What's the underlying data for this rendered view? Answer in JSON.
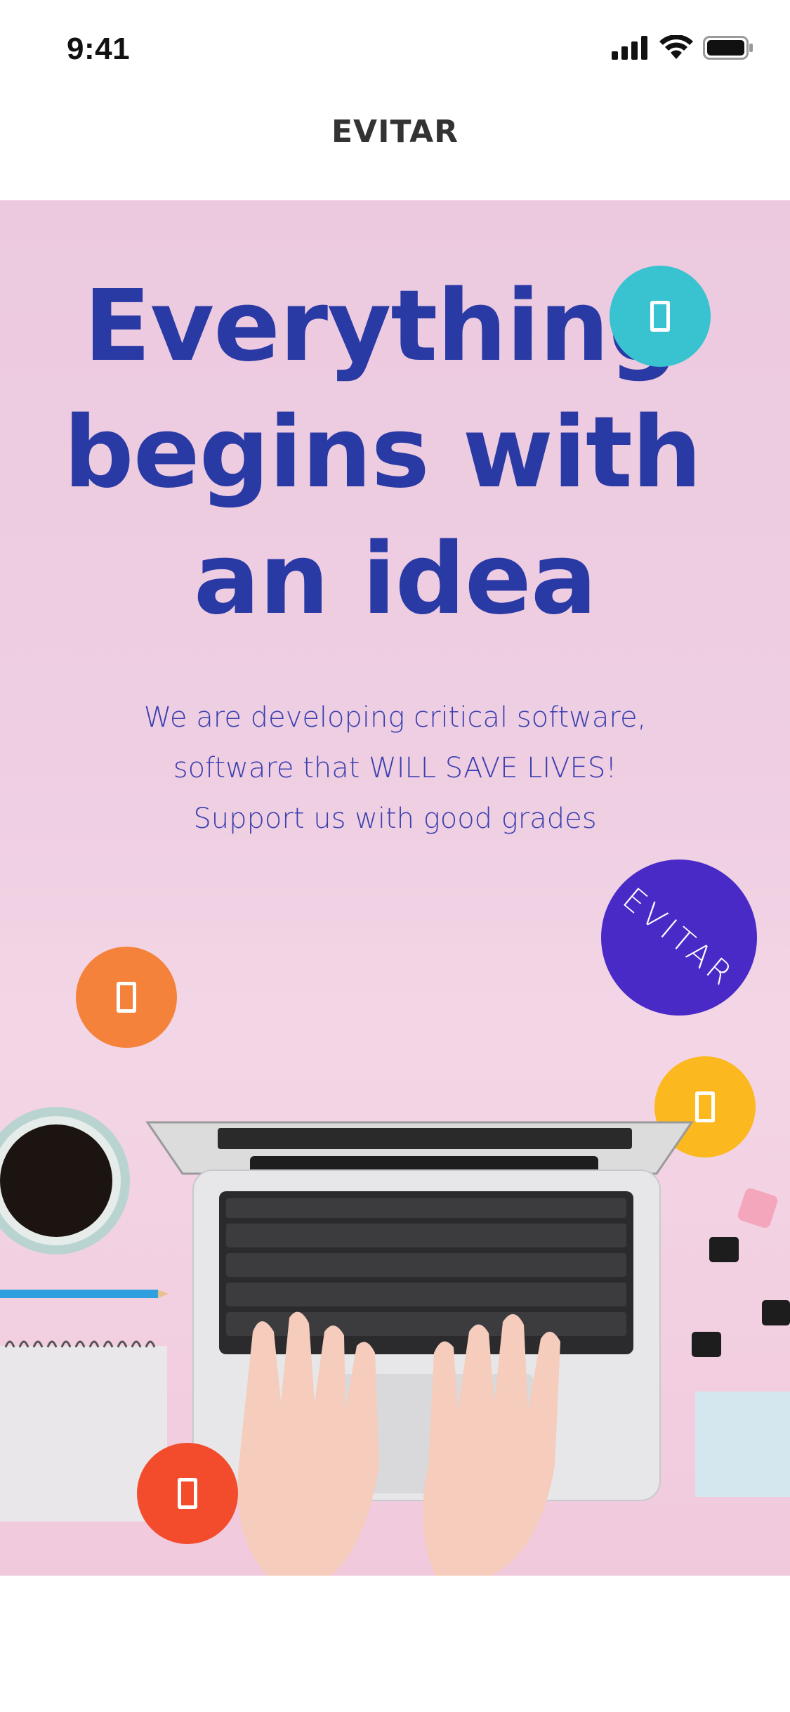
{
  "status_bar": {
    "time": "9:41",
    "icons": [
      "signal-icon",
      "wifi-icon",
      "battery-icon"
    ]
  },
  "nav": {
    "title": "EVITAR"
  },
  "hero": {
    "headline": [
      "Everything",
      "begins with",
      "an idea"
    ],
    "subtext": [
      "We are developing critical software,",
      "software that WILL SAVE LIVES!",
      "Support us with good grades"
    ],
    "logo_badge_text": "EVITAR"
  },
  "colors": {
    "headline": "#2a3aa5",
    "subtext": "#3b3fb0",
    "teal": "#39c2cf",
    "orange": "#f4823b",
    "yellow": "#fbb81f",
    "red": "#f24c2c",
    "purple": "#4a2ac6",
    "background_pink": "#ecc9df"
  },
  "floating_buttons": [
    {
      "name": "teal-action",
      "color": "teal",
      "icon": "box-icon"
    },
    {
      "name": "orange-action",
      "color": "orange",
      "icon": "box-icon"
    },
    {
      "name": "yellow-action",
      "color": "yellow",
      "icon": "box-icon"
    },
    {
      "name": "red-action",
      "color": "red",
      "icon": "box-icon"
    }
  ]
}
